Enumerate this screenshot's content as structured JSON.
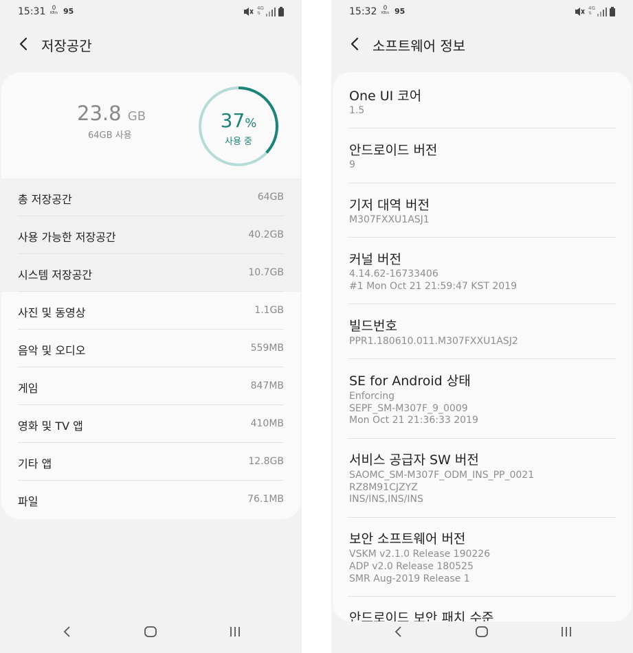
{
  "status_left": {
    "time": "15:31",
    "net_speed": "0",
    "net_unit": "KB/s",
    "battery_level": "95",
    "network_type": "4G",
    "icons": [
      "mute-icon",
      "4g-icon",
      "signal-icon",
      "battery-icon"
    ]
  },
  "status_right": {
    "time": "15:32",
    "net_speed": "0",
    "net_unit": "KB/s",
    "battery_level": "95",
    "network_type": "4G",
    "icons": [
      "mute-icon",
      "4g-icon",
      "signal-icon",
      "battery-icon"
    ]
  },
  "storage": {
    "title": "저장공간",
    "used_amount": "23.8",
    "used_unit": "GB",
    "capacity_caption": "64GB 사용",
    "percent": "37",
    "percent_sign": "%",
    "percent_caption": "사용 중",
    "percent_fraction": 0.37,
    "accent_color": "#1a8577",
    "ring_track_color": "#b5dcd6",
    "rows": [
      {
        "label": "총 저장공간",
        "value": "64GB"
      },
      {
        "label": "사용 가능한 저장공간",
        "value": "40.2GB"
      },
      {
        "label": "시스템 저장공간",
        "value": "10.7GB"
      },
      {
        "label": "사진 및 동영상",
        "value": "1.1GB"
      },
      {
        "label": "음악 및 오디오",
        "value": "559MB"
      },
      {
        "label": "게임",
        "value": "847MB"
      },
      {
        "label": "영화 및 TV 앱",
        "value": "410MB"
      },
      {
        "label": "기타 앱",
        "value": "12.8GB"
      },
      {
        "label": "파일",
        "value": "76.1MB"
      }
    ]
  },
  "software": {
    "title": "소프트웨어 정보",
    "items": [
      {
        "label": "One UI 코어",
        "lines": [
          "1.5"
        ]
      },
      {
        "label": "안드로이드 버전",
        "lines": [
          "9"
        ]
      },
      {
        "label": "기저 대역 버전",
        "lines": [
          "M307FXXU1ASJ1"
        ]
      },
      {
        "label": "커널 버전",
        "lines": [
          "4.14.62-16733406",
          "#1 Mon Oct 21 21:59:47 KST 2019"
        ]
      },
      {
        "label": "빌드번호",
        "lines": [
          "PPR1.180610.011.M307FXXU1ASJ2"
        ]
      },
      {
        "label": "SE for Android 상태",
        "lines": [
          "Enforcing",
          "SEPF_SM-M307F_9_0009",
          "Mon Oct 21 21:36:33 2019"
        ]
      },
      {
        "label": "서비스 공급자 SW 버전",
        "lines": [
          "SAOMC_SM-M307F_ODM_INS_PP_0021",
          "RZ8M91CJZYZ",
          "INS/INS,INS/INS"
        ]
      },
      {
        "label": "보안 소프트웨어 버전",
        "lines": [
          "VSKM v2.1.0 Release 190226",
          "ADP v2.0 Release 180525",
          "SMR Aug-2019 Release 1"
        ]
      },
      {
        "label": "안드로이드 보안 패치 수준",
        "lines": []
      }
    ]
  },
  "nav": {
    "icons": [
      "back-nav-icon",
      "home-nav-icon",
      "recents-nav-icon"
    ]
  }
}
